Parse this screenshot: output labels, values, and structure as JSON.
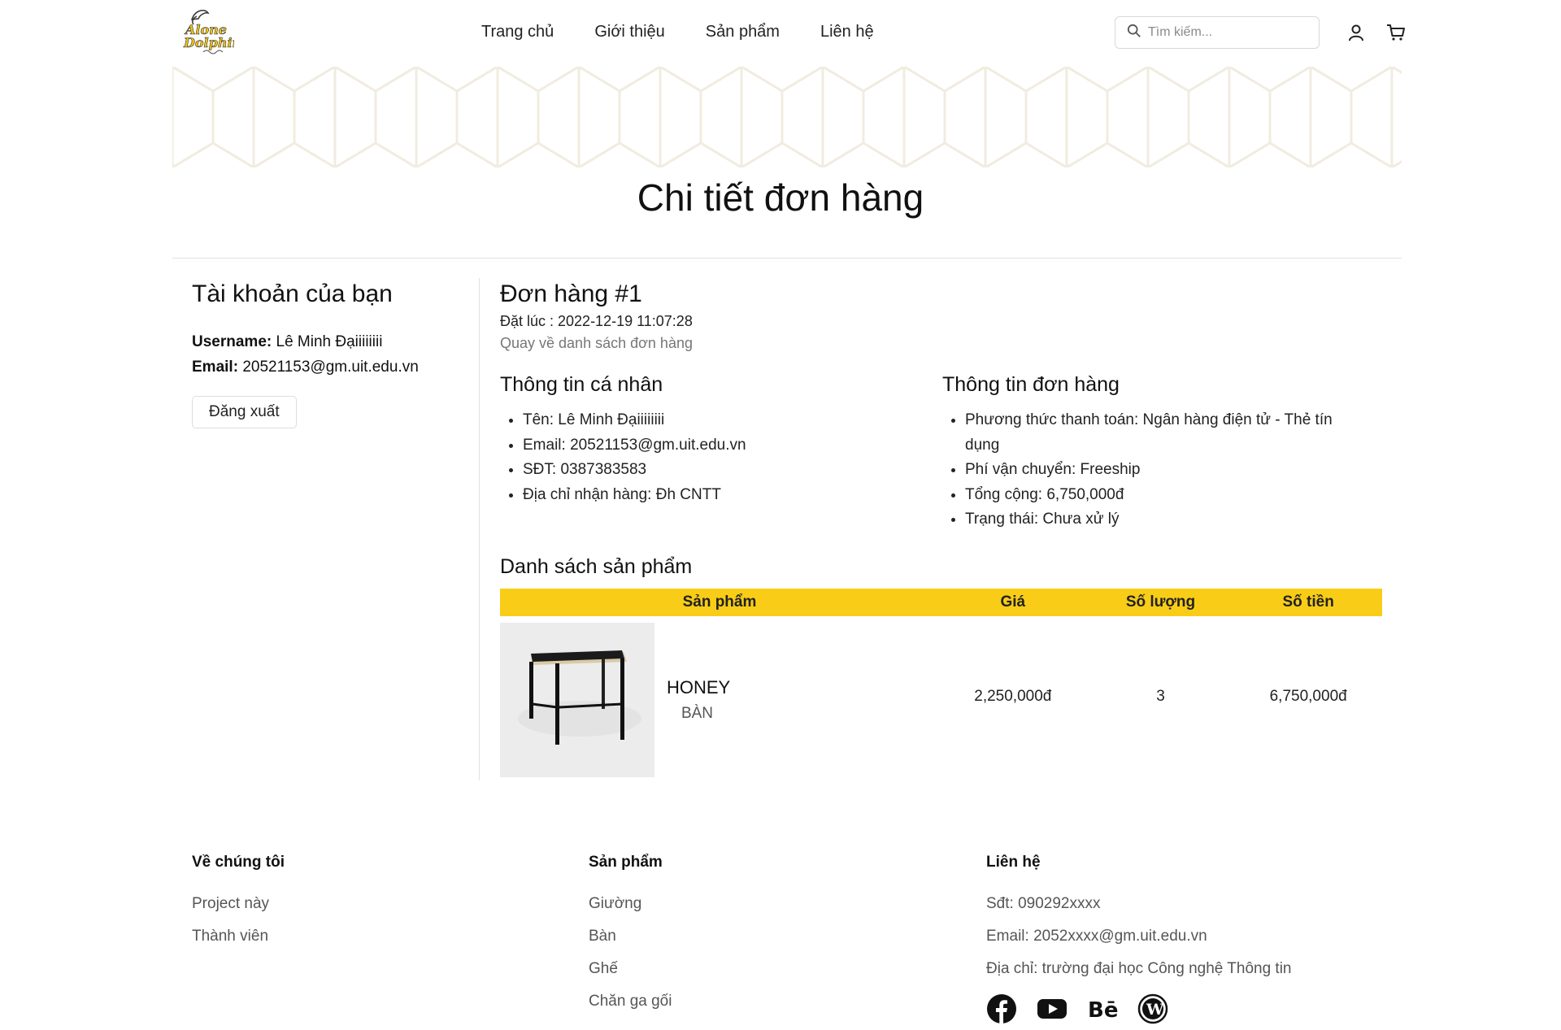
{
  "header": {
    "logo_text": "Alone Dolphin",
    "nav": [
      "Trang chủ",
      "Giới thiệu",
      "Sản phẩm",
      "Liên hệ"
    ],
    "search_placeholder": "Tìm kiếm...",
    "icons": [
      "search-icon",
      "user-icon",
      "cart-icon"
    ]
  },
  "page_title": "Chi tiết đơn hàng",
  "sidebar": {
    "title": "Tài khoản của bạn",
    "username_label": "Username:",
    "username": "Lê Minh Đạiiiiiiii",
    "email_label": "Email:",
    "email": "20521153@gm.uit.edu.vn",
    "logout_label": "Đăng xuất"
  },
  "order": {
    "title": "Đơn hàng #1",
    "placed_at": "Đặt lúc : 2022-12-19 11:07:28",
    "back_link": "Quay về danh sách đơn hàng",
    "personal": {
      "title": "Thông tin cá nhân",
      "items": [
        "Tên: Lê Minh Đạiiiiiiii",
        "Email: 20521153@gm.uit.edu.vn",
        "SĐT: 0387383583",
        "Địa chỉ nhận hàng: Đh CNTT"
      ]
    },
    "info": {
      "title": "Thông tin đơn hàng",
      "items": [
        "Phương thức thanh toán: Ngân hàng điện tử - Thẻ tín dụng",
        "Phí vận chuyển: Freeship",
        "Tổng cộng: 6,750,000đ",
        "Trạng thái: Chưa xử lý"
      ]
    },
    "products_title": "Danh sách sản phẩm",
    "table": {
      "headers": [
        "Sản phẩm",
        "Giá",
        "Số lượng",
        "Số tiền"
      ],
      "rows": [
        {
          "name": "HONEY",
          "category": "BÀN",
          "price": "2,250,000đ",
          "qty": "3",
          "amount": "6,750,000đ"
        }
      ]
    }
  },
  "footer": {
    "about": {
      "title": "Về chúng tôi",
      "links": [
        "Project này",
        "Thành viên"
      ]
    },
    "products": {
      "title": "Sản phẩm",
      "links": [
        "Giường",
        "Bàn",
        "Ghế",
        "Chăn ga gối"
      ]
    },
    "contact": {
      "title": "Liên hệ",
      "lines": [
        "Sđt: 090292xxxx",
        "Email: 2052xxxx@gm.uit.edu.vn",
        "Địa chỉ: trường đại học Công nghệ Thông tin"
      ],
      "social": [
        "facebook-icon",
        "youtube-icon",
        "behance-icon",
        "wordpress-icon"
      ]
    }
  },
  "colors": {
    "accent": "#f9cd17",
    "text": "#111111",
    "muted": "#555555"
  }
}
